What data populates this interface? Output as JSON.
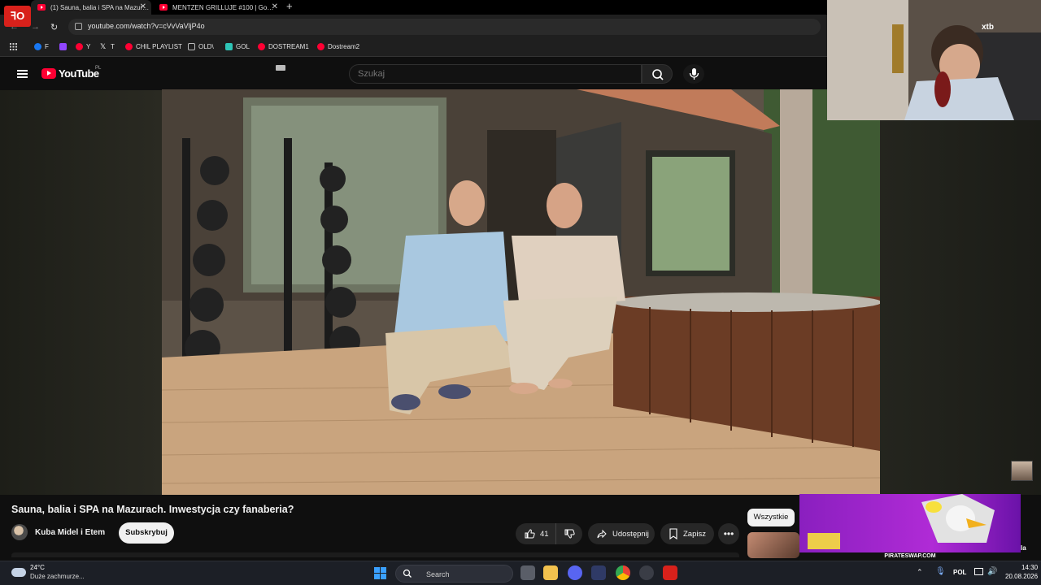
{
  "browser": {
    "tabs": [
      {
        "label": "(1) Sauna, balia i SPA na Mazur…"
      },
      {
        "label": "MENTZEN GRILLUJE #100 | Go…"
      }
    ],
    "new_tab_label": "+",
    "url": "youtube.com/watch?v=cVvVaVljP4o",
    "bookmarks": [
      {
        "label": "F",
        "icon": "facebook-icon"
      },
      {
        "label": "",
        "icon": "twitch-icon"
      },
      {
        "label": "Y",
        "icon": "youtube-icon"
      },
      {
        "label": "T",
        "icon": "x-icon"
      },
      {
        "label": "CHIL PLAYLIST",
        "icon": "youtube-icon"
      },
      {
        "label": "OLD\\",
        "icon": "folder-icon"
      },
      {
        "label": "GOL",
        "icon": "gol-icon"
      },
      {
        "label": "DOSTREAM1",
        "icon": "youtube-icon"
      },
      {
        "label": "Dostream2",
        "icon": "youtube-icon"
      }
    ]
  },
  "youtube": {
    "logo_text": "YouTube",
    "country_code": "PL",
    "search_placeholder": "Szukaj",
    "video": {
      "title": "Sauna, balia i SPA na Mazurach. Inwestycja czy fanaberia?",
      "channel": "Kuba Midel i Etem",
      "subscribe_label": "Subskrybuj",
      "likes": "41",
      "share_label": "Udostępnij",
      "save_label": "Zapisz"
    },
    "filter_chip": "Wszystkie"
  },
  "overlay": {
    "stream_logo": "ꟻO",
    "sponsor": "xtb",
    "ad_caption": "PIRATESWAP.COM",
    "side_label": "la"
  },
  "taskbar": {
    "weather_temp": "24°C",
    "weather_desc": "Duże zachmurze...",
    "search_label": "Search",
    "language": "POL",
    "time": "14:30",
    "date": "20.08.2026"
  },
  "colors": {
    "youtube_red": "#ff0033",
    "page_bg": "#0f0f0f",
    "accent_blue": "#3aa0ff"
  }
}
